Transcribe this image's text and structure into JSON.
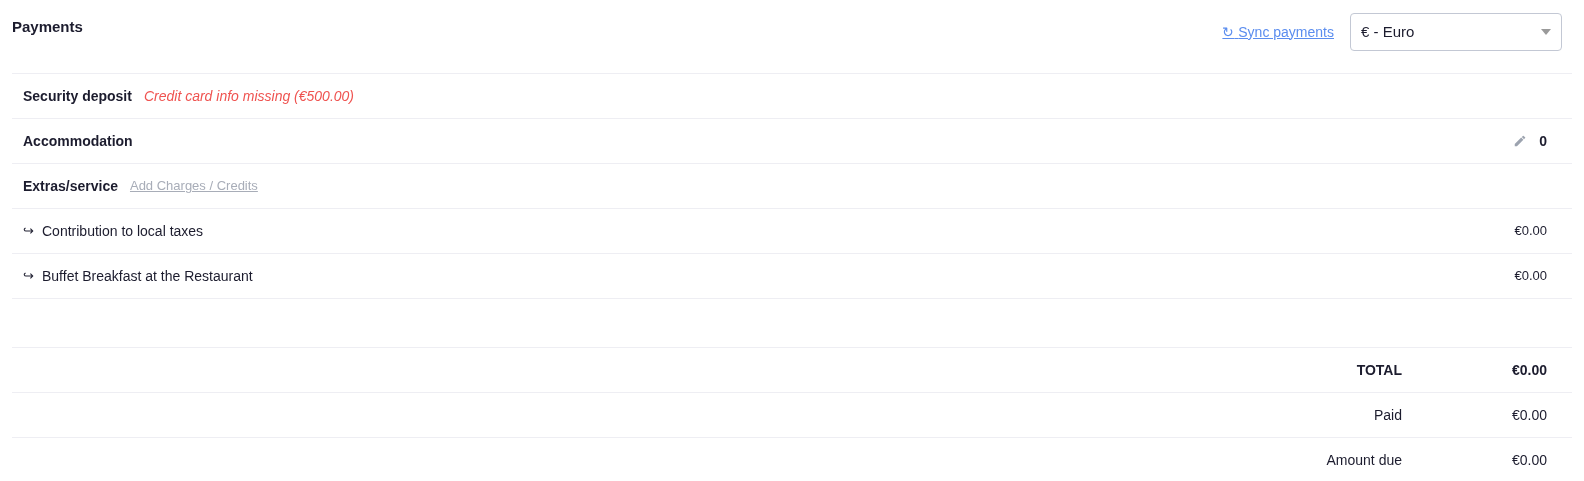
{
  "title": "Payments",
  "sync_link": {
    "icon": "↻",
    "label": "Sync payments"
  },
  "currency_select": {
    "value": "€ - Euro"
  },
  "rows": [
    {
      "kind": "section",
      "label": "Security deposit",
      "warning": "Credit card info missing (€500.00)"
    },
    {
      "kind": "section",
      "label": "Accommodation",
      "editable": true,
      "amount": "0"
    },
    {
      "kind": "section",
      "label": "Extras/service",
      "link": "Add Charges / Credits"
    },
    {
      "kind": "item",
      "arrow": "↪",
      "label": "Contribution to local taxes",
      "amount": "€0.00"
    },
    {
      "kind": "item",
      "arrow": "↪",
      "label": "Buffet Breakfast at the Restaurant",
      "amount": "€0.00"
    }
  ],
  "totals": [
    {
      "label": "TOTAL",
      "value": "€0.00",
      "bold": true
    },
    {
      "label": "Paid",
      "value": "€0.00",
      "bold": false
    },
    {
      "label": "Amount due",
      "value": "€0.00",
      "bold": false
    }
  ]
}
